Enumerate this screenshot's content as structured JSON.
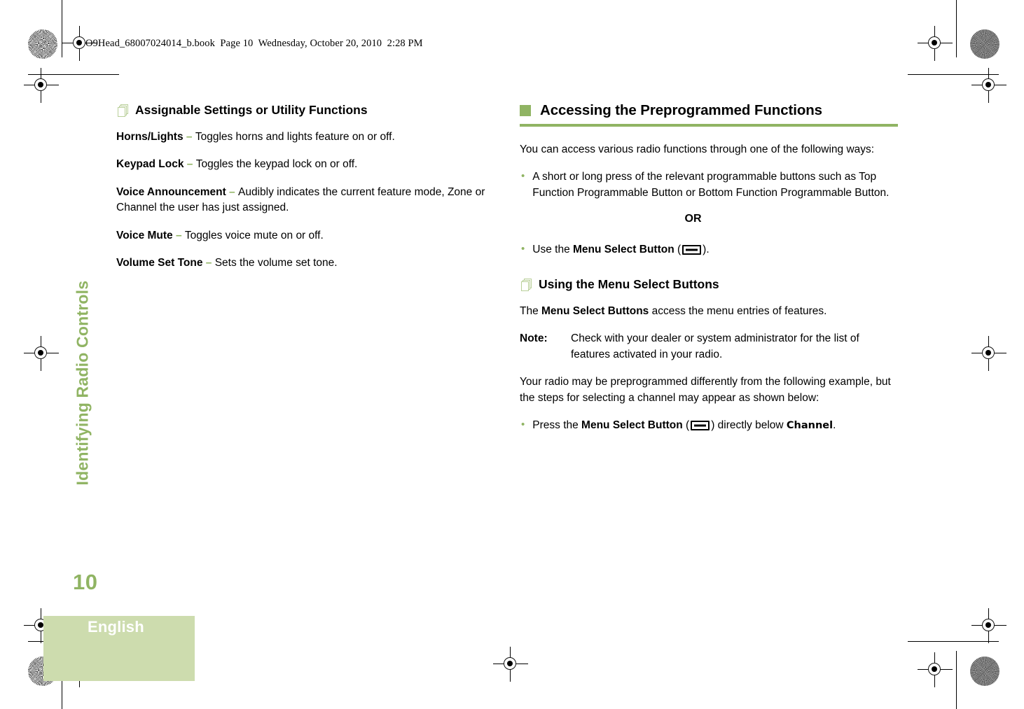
{
  "slug": {
    "text": "O9Head_68007024014_b.book  Page 10  Wednesday, October 20, 2010  2:28 PM"
  },
  "sidebar": {
    "chapter_title": "Identifying Radio Controls",
    "page_number": "10",
    "language": "English"
  },
  "colors": {
    "green_accent": "#90b463",
    "green_light_box": "#cddcae",
    "icon_outline": "#b9cf99"
  },
  "left_column": {
    "heading": {
      "icon": "pages-stack-icon",
      "label": "Assignable Settings or Utility Functions"
    },
    "entries": [
      {
        "term": "Horns/Lights",
        "dash": "–",
        "description": "Toggles horns and lights feature on or off."
      },
      {
        "term": "Keypad Lock",
        "dash": "–",
        "description": "Toggles the keypad lock on or off."
      },
      {
        "term": "Voice Announcement",
        "dash": "–",
        "description": "Audibly indicates the current feature mode, Zone or Channel the user has just assigned."
      },
      {
        "term": "Voice Mute",
        "dash": "–",
        "description": "Toggles voice mute on or off."
      },
      {
        "term": "Volume Set Tone",
        "dash": "–",
        "description": "Sets the volume set tone."
      }
    ]
  },
  "right_column": {
    "section_heading": {
      "marker": "green-square-icon",
      "label": "Accessing the Preprogrammed Functions"
    },
    "intro": "You can access various radio functions through one of the following ways:",
    "bullet_1": "A short or long press of the relevant programmable buttons such as Top Function Programmable Button or Bottom Function Programmable Button.",
    "or_label": "OR",
    "bullet_2": {
      "prefix": "Use the ",
      "bold": "Menu Select Button",
      "open_paren": "(",
      "icon": "menu-select-button-icon",
      "close_paren": ").",
      "suffix": ""
    },
    "subheading": {
      "icon": "pages-stack-icon",
      "label": "Using the Menu Select Buttons"
    },
    "para_1": {
      "prefix": "The ",
      "bold": "Menu Select Buttons",
      "suffix": " access the menu entries of features."
    },
    "note": {
      "label": "Note:",
      "body": "Check with your dealer or system administrator for the list of features activated in your radio."
    },
    "para_2": "Your radio may be preprogrammed differently from the following example, but the steps for selecting a channel may appear as shown below:",
    "bullet_3": {
      "prefix": "Press the ",
      "bold": "Menu Select Button",
      "open_paren": "(",
      "icon": "menu-select-button-icon",
      "close_paren": ")",
      "mid": " directly below ",
      "screen_label": "Channel",
      "period": "."
    }
  }
}
